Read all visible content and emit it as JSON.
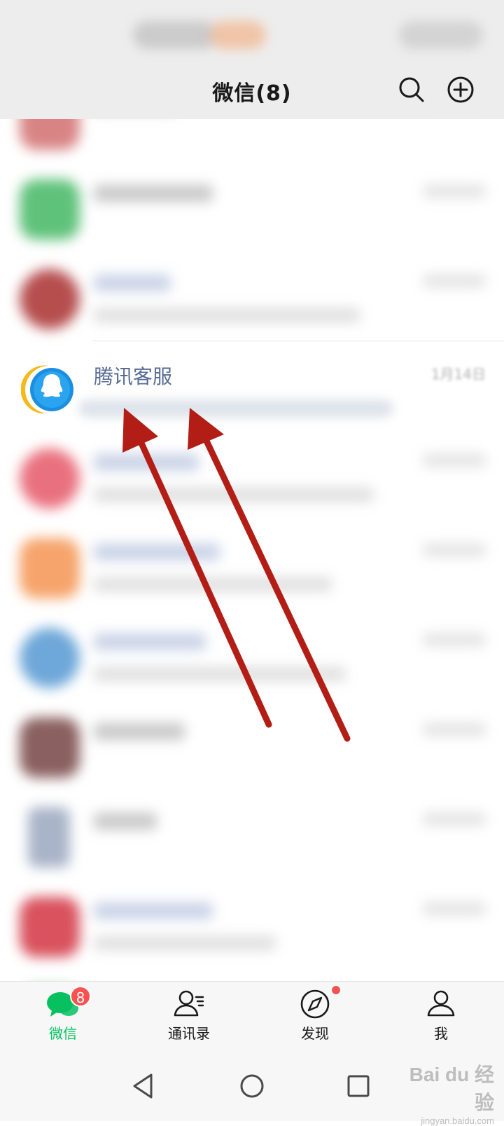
{
  "header": {
    "title": "微信(8)",
    "search_icon": "search-icon",
    "add_icon": "plus-circle-icon"
  },
  "chat_list": {
    "focused_contact": {
      "name": "腾讯客服",
      "time": "1月14日",
      "avatar_icon": "qq-penguin-icon"
    }
  },
  "tabbar": {
    "tabs": [
      {
        "label": "微信",
        "icon": "chat-bubbles-icon",
        "badge": "8",
        "active": true
      },
      {
        "label": "通讯录",
        "icon": "contacts-icon",
        "active": false
      },
      {
        "label": "发现",
        "icon": "compass-icon",
        "dot": true,
        "active": false
      },
      {
        "label": "我",
        "icon": "person-icon",
        "active": false
      }
    ]
  },
  "navigation": {
    "back_icon": "triangle-back-icon",
    "home_icon": "circle-home-icon",
    "recents_icon": "square-recents-icon"
  },
  "watermark": {
    "main": "Bai du 经验",
    "sub": "jingyan.baidu.com"
  },
  "colors": {
    "accent_green": "#07c160",
    "badge_red": "#fa5151",
    "name_blue": "#576b95",
    "arrow_red": "#b21e16"
  }
}
